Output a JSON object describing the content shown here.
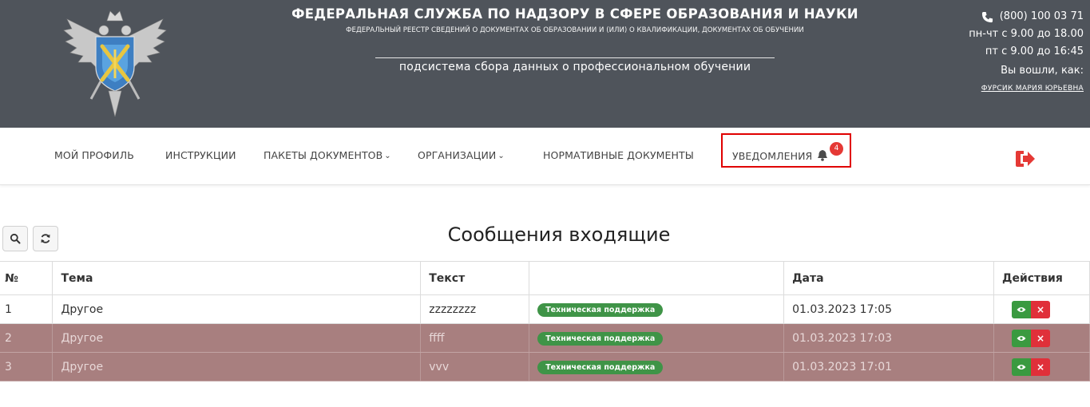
{
  "header": {
    "org_title": "ФЕДЕРАЛЬНАЯ СЛУЖБА ПО НАДЗОРУ В СФЕРЕ ОБРАЗОВАНИЯ И НАУКИ",
    "org_subtitle": "ФЕДЕРАЛЬНЫЙ РЕЕСТР СВЕДЕНИЙ О ДОКУМЕНТАХ ОБ ОБРАЗОВАНИИ И (ИЛИ) О КВАЛИФИКАЦИИ, ДОКУМЕНТАХ ОБ ОБУЧЕНИИ",
    "subsystem": "подсистема сбора данных о профессиональном обучении",
    "phone": "(800) 100 03 71",
    "hours_mon_thu": "пн-чт с 9.00 до 18.00",
    "hours_fri": "пт с 9.00 до 16:45",
    "logged_in_label": "Вы вошли, как:",
    "user_name": "ФУРСИК МАРИЯ ЮРЬЕВНА"
  },
  "nav": {
    "items": [
      {
        "label": "МОЙ ПРОФИЛЬ"
      },
      {
        "label": "ИНСТРУКЦИИ"
      },
      {
        "label": "ПАКЕТЫ ДОКУМЕНТОВ"
      },
      {
        "label": "ОРГАНИЗАЦИИ"
      },
      {
        "label": "НОРМАТИВНЫЕ ДОКУМЕНТЫ"
      },
      {
        "label": "УВЕДОМЛЕНИЯ"
      }
    ],
    "notification_count": "4",
    "logout_icon": "logout-icon"
  },
  "toolbar": {
    "search_icon": "search-icon",
    "refresh_icon": "refresh-icon"
  },
  "page": {
    "heading": "Сообщения входящие"
  },
  "table": {
    "headers": [
      "№",
      "Тема",
      "Текст",
      "",
      "Дата",
      "Действия"
    ],
    "rows": [
      {
        "num": "1",
        "topic": "Другое",
        "text": "zzzzzzzz",
        "tag": "Техническая поддержка",
        "date": "01.03.2023 17:05"
      },
      {
        "num": "2",
        "topic": "Другое",
        "text": "ffff",
        "tag": "Техническая поддержка",
        "date": "01.03.2023 17:03"
      },
      {
        "num": "3",
        "topic": "Другое",
        "text": "vvv",
        "tag": "Техническая поддержка",
        "date": "01.03.2023 17:01"
      }
    ],
    "row_highlight_color": "#a87f7f",
    "tag_color": "#3f9447"
  }
}
